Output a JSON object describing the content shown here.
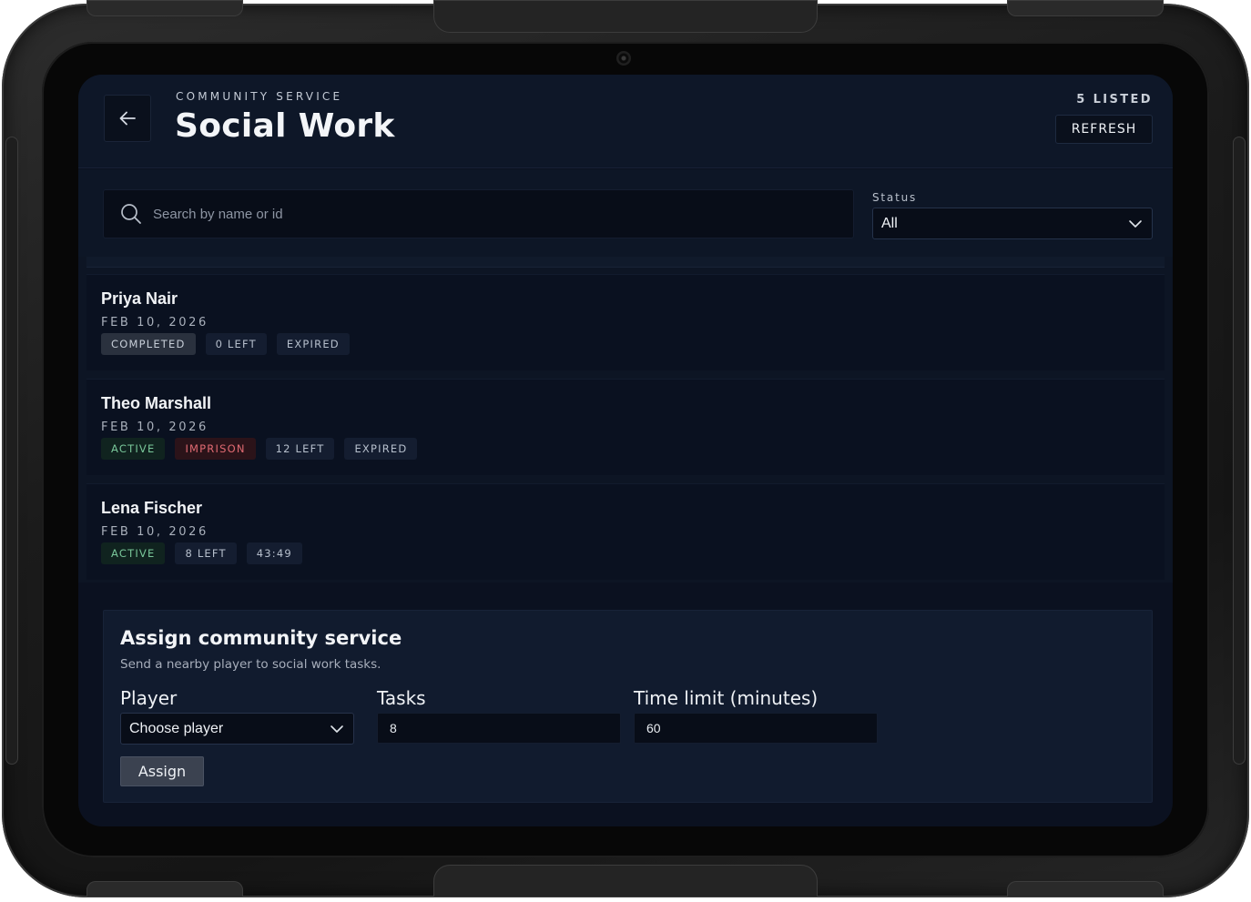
{
  "header": {
    "kicker": "COMMUNITY SERVICE",
    "title": "Social Work",
    "count": "5 LISTED",
    "refresh_label": "REFRESH"
  },
  "filters": {
    "search_placeholder": "Search by name or id",
    "search_value": "",
    "status_label": "Status",
    "status_value": "All"
  },
  "records": [
    {
      "name": "Priya Nair",
      "date": "FEB 10, 2026",
      "tags": [
        {
          "label": "COMPLETED",
          "kind": "completed"
        },
        {
          "label": "0 LEFT",
          "kind": "neutral"
        },
        {
          "label": "EXPIRED",
          "kind": "neutral"
        }
      ]
    },
    {
      "name": "Theo Marshall",
      "date": "FEB 10, 2026",
      "tags": [
        {
          "label": "ACTIVE",
          "kind": "active"
        },
        {
          "label": "IMPRISON",
          "kind": "imprison"
        },
        {
          "label": "12 LEFT",
          "kind": "neutral"
        },
        {
          "label": "EXPIRED",
          "kind": "neutral"
        }
      ]
    },
    {
      "name": "Lena Fischer",
      "date": "FEB 10, 2026",
      "tags": [
        {
          "label": "ACTIVE",
          "kind": "active"
        },
        {
          "label": "8 LEFT",
          "kind": "neutral"
        },
        {
          "label": "43:49",
          "kind": "neutral"
        }
      ]
    }
  ],
  "assign": {
    "title": "Assign community service",
    "subtitle": "Send a nearby player to social work tasks.",
    "player_label": "Player",
    "player_value": "Choose player",
    "tasks_label": "Tasks",
    "tasks_value": "8",
    "time_label": "Time limit (minutes)",
    "time_value": "60",
    "button_label": "Assign"
  },
  "icons": {
    "back": "arrow-left-icon",
    "search": "search-icon",
    "dropdown": "chevron-down-icon",
    "camera": "camera-icon"
  },
  "colors": {
    "screen_bg": "#0b1120",
    "active_tag": "#79c79a",
    "imprison_tag": "#e06a72"
  }
}
